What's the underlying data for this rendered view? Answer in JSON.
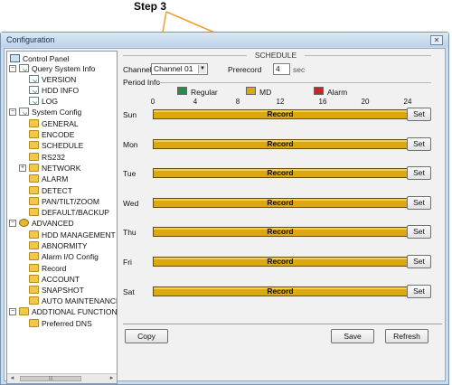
{
  "annotation": {
    "label": "Step 3"
  },
  "window": {
    "title": "Configuration",
    "close_glyph": "✕"
  },
  "tree": {
    "items": [
      {
        "label": "Control Panel",
        "icon": "control-panel-icon"
      },
      {
        "label": "Query System Info",
        "icon": "query-icon"
      },
      {
        "label": "VERSION",
        "icon": "doc-icon"
      },
      {
        "label": "HDD INFO",
        "icon": "doc-icon"
      },
      {
        "label": "LOG",
        "icon": "doc-icon"
      },
      {
        "label": "System Config",
        "icon": "doc-icon"
      },
      {
        "label": "GENERAL",
        "icon": "folder-icon"
      },
      {
        "label": "ENCODE",
        "icon": "folder-icon"
      },
      {
        "label": "SCHEDULE",
        "icon": "folder-icon"
      },
      {
        "label": "RS232",
        "icon": "folder-icon"
      },
      {
        "label": "NETWORK",
        "icon": "folder-icon"
      },
      {
        "label": "ALARM",
        "icon": "folder-icon"
      },
      {
        "label": "DETECT",
        "icon": "folder-icon"
      },
      {
        "label": "PAN/TILT/ZOOM",
        "icon": "folder-icon"
      },
      {
        "label": "DEFAULT/BACKUP",
        "icon": "folder-icon"
      },
      {
        "label": "ADVANCED",
        "icon": "gear-icon"
      },
      {
        "label": "HDD MANAGEMENT",
        "icon": "folder-icon"
      },
      {
        "label": "ABNORMITY",
        "icon": "folder-icon"
      },
      {
        "label": "Alarm I/O Config",
        "icon": "folder-icon"
      },
      {
        "label": "Record",
        "icon": "folder-icon"
      },
      {
        "label": "ACCOUNT",
        "icon": "folder-icon"
      },
      {
        "label": "SNAPSHOT",
        "icon": "folder-icon"
      },
      {
        "label": "AUTO MAINTENANCE",
        "icon": "folder-icon"
      },
      {
        "label": "ADDTIONAL FUNCTION",
        "icon": "folder-icon"
      },
      {
        "label": "Preferred DNS",
        "icon": "folder-icon"
      }
    ],
    "scroll_thumb_glyph": "|||"
  },
  "schedule": {
    "section_title": "SCHEDULE",
    "channel_label": "Channel",
    "channel_value": "Channel 01",
    "prerecord_label": "Prerecord",
    "prerecord_value": "4",
    "prerecord_unit": "sec",
    "period_info_label": "Period Info",
    "legend": [
      {
        "label": "Regular",
        "color": "#2a8a4a"
      },
      {
        "label": "MD",
        "color": "#dca80f"
      },
      {
        "label": "Alarm",
        "color": "#c0282a"
      }
    ],
    "ticks": [
      "0",
      "4",
      "8",
      "12",
      "16",
      "20",
      "24"
    ],
    "days": [
      {
        "day": "Sun",
        "bar_label": "Record",
        "set_label": "Set"
      },
      {
        "day": "Mon",
        "bar_label": "Record",
        "set_label": "Set"
      },
      {
        "day": "Tue",
        "bar_label": "Record",
        "set_label": "Set"
      },
      {
        "day": "Wed",
        "bar_label": "Record",
        "set_label": "Set"
      },
      {
        "day": "Thu",
        "bar_label": "Record",
        "set_label": "Set"
      },
      {
        "day": "Fri",
        "bar_label": "Record",
        "set_label": "Set"
      },
      {
        "day": "Sat",
        "bar_label": "Record",
        "set_label": "Set"
      }
    ],
    "buttons": {
      "copy": "Copy",
      "save": "Save",
      "refresh": "Refresh"
    }
  }
}
